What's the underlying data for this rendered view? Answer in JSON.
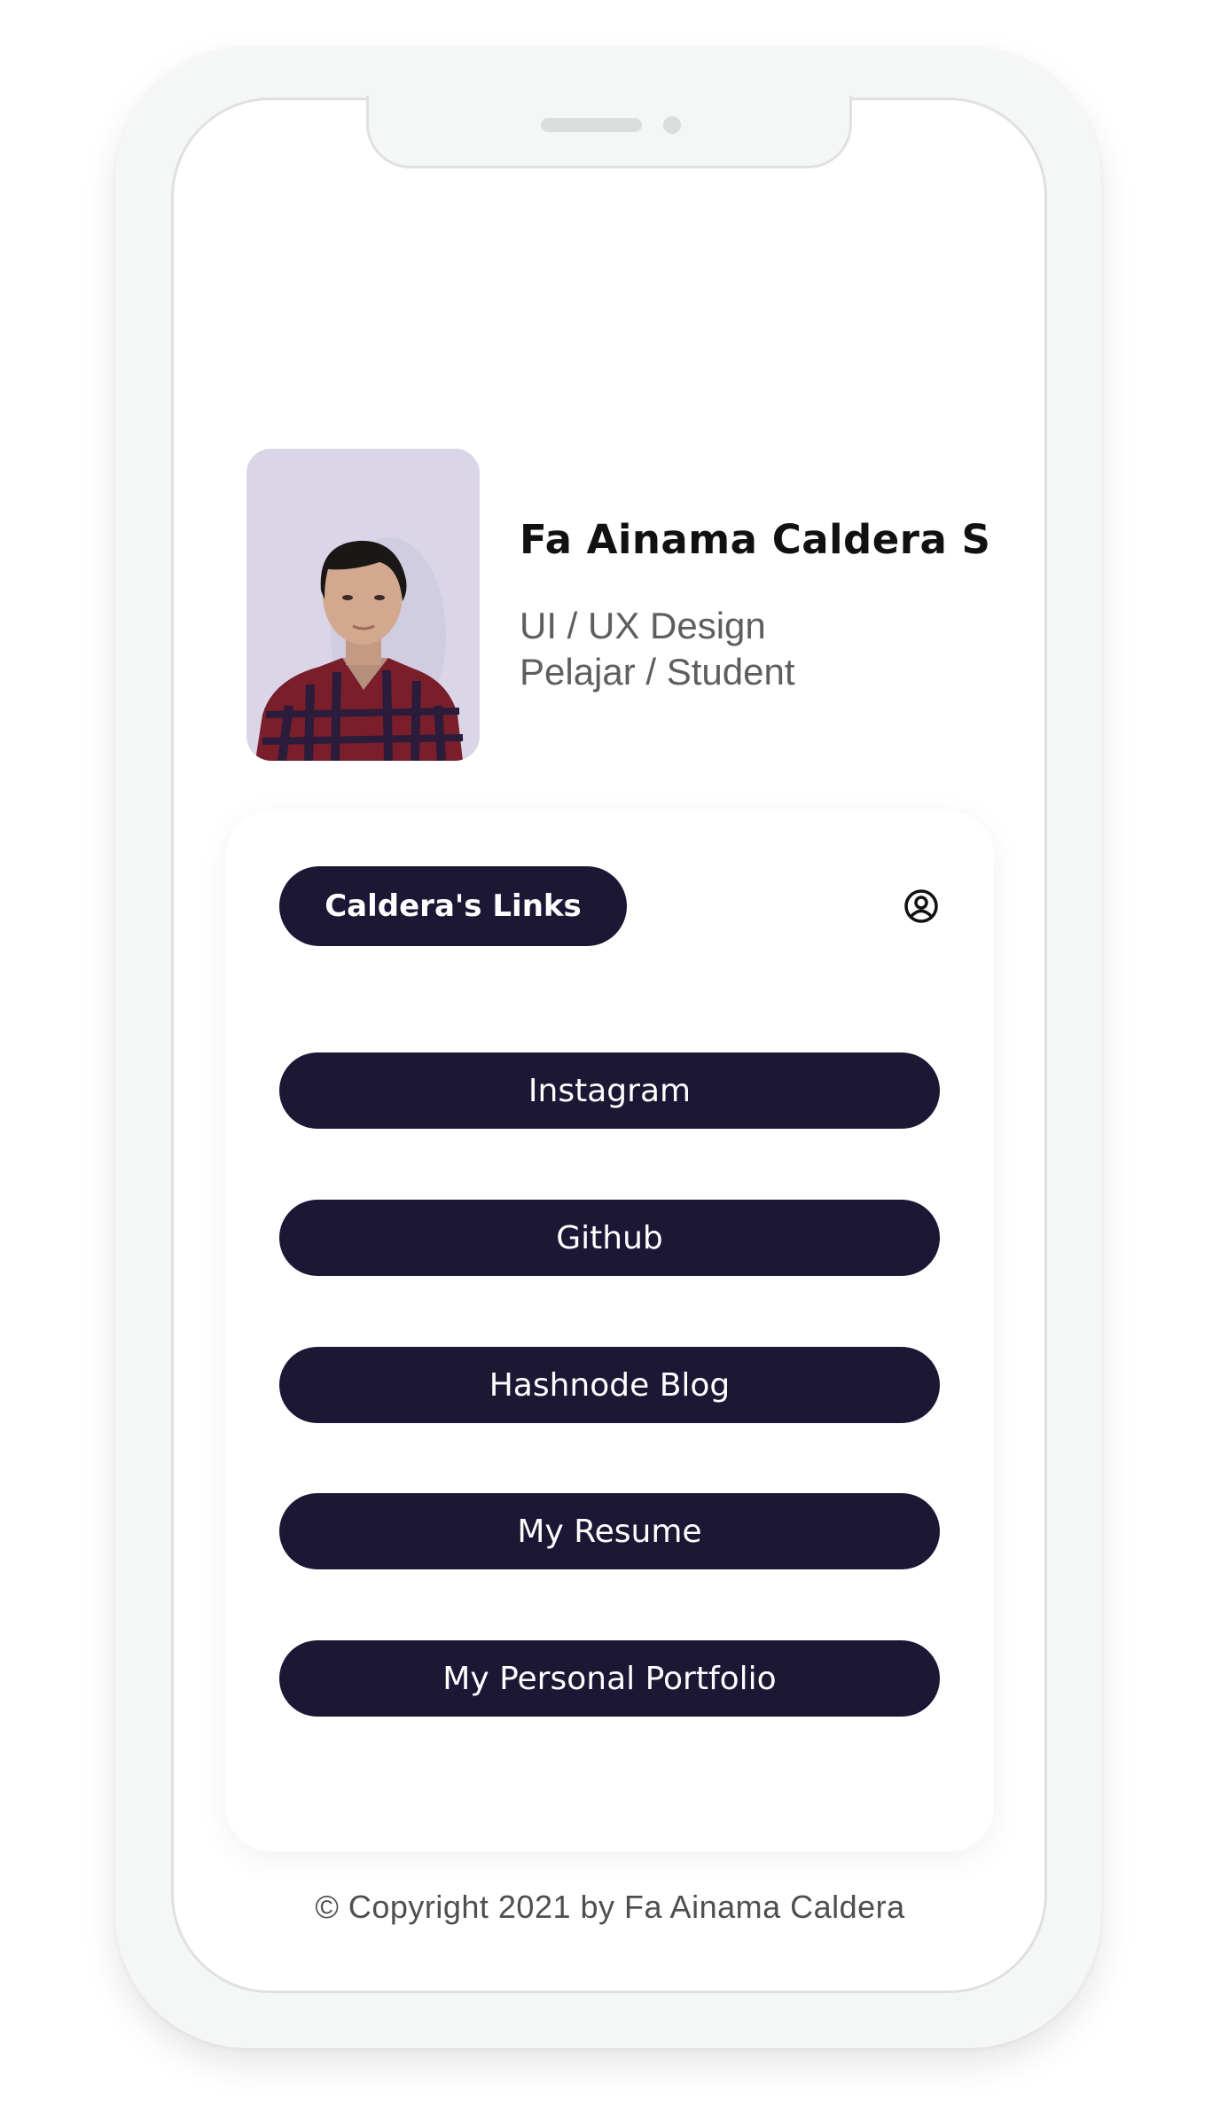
{
  "profile": {
    "name": "Fa Ainama Caldera S",
    "role_line1": "UI / UX Design",
    "role_line2": "Pelajar / Student"
  },
  "links_card": {
    "title": "Caldera's Links",
    "account_icon": "user-circle-icon",
    "links": [
      {
        "label": "Instagram"
      },
      {
        "label": "Github"
      },
      {
        "label": "Hashnode Blog"
      },
      {
        "label": "My Resume"
      },
      {
        "label": "My Personal Portfolio"
      }
    ]
  },
  "footer": {
    "copyright": "© Copyright 2021 by Fa Ainama Caldera"
  },
  "colors": {
    "button_bg": "#1b1734",
    "button_text": "#ffffff",
    "name_text": "#111111",
    "subtitle_text": "#5e5e5e"
  }
}
